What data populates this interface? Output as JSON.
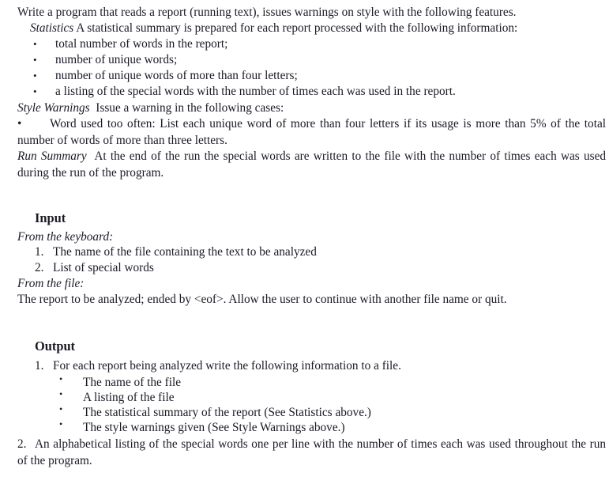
{
  "document": {
    "intro": "Write a program that reads a report (running text), issues warnings on style with the following features.",
    "statistics": {
      "term": "Statistics",
      "text": "A statistical summary is prepared for each report processed with the following information:",
      "bullets": [
        "total number of words in the report;",
        "number of unique words;",
        "number of unique words of more than four letters;",
        "a listing of the special words with the number of times each was used in the report."
      ],
      "bullet_glyph": "•"
    },
    "style_warnings": {
      "term": "Style Warnings",
      "text": "Issue a warning in the following cases:",
      "bullet_glyph": "•",
      "bullets": [
        "Word used too often:  List each unique word of more than four letters if its usage is more than 5% of the total number of words of more than three letters."
      ]
    },
    "run_summary": {
      "term": "Run  Summary",
      "text": "At the end of the run the special words are written to the file with the number of times each was used during the run of the program."
    },
    "input_section": {
      "heading": "Input",
      "keyboard_label": "From the keyboard:",
      "keyboard_items": [
        {
          "marker": "1.",
          "text": "The name of the file containing the text to be analyzed"
        },
        {
          "marker": "2.",
          "text": "List of special words"
        }
      ],
      "file_label": "From the file:",
      "file_text": "The report to be analyzed; ended by <eof>.  Allow the user to continue with another file name or quit."
    },
    "output_section": {
      "heading": "Output",
      "item1": {
        "marker": "1.",
        "text": "For each report being analyzed write the following information to a file."
      },
      "bullet_glyph": "•",
      "item1_bullets": [
        "The name of the file",
        "A listing of the file",
        "The statistical summary of the report  (See Statistics above.)",
        "The style warnings given  (See Style Warnings above.)"
      ],
      "item2": {
        "marker": "2.",
        "text": "An alphabetical listing of the special words one per line with the number of times each was used throughout the run of the program."
      }
    }
  }
}
